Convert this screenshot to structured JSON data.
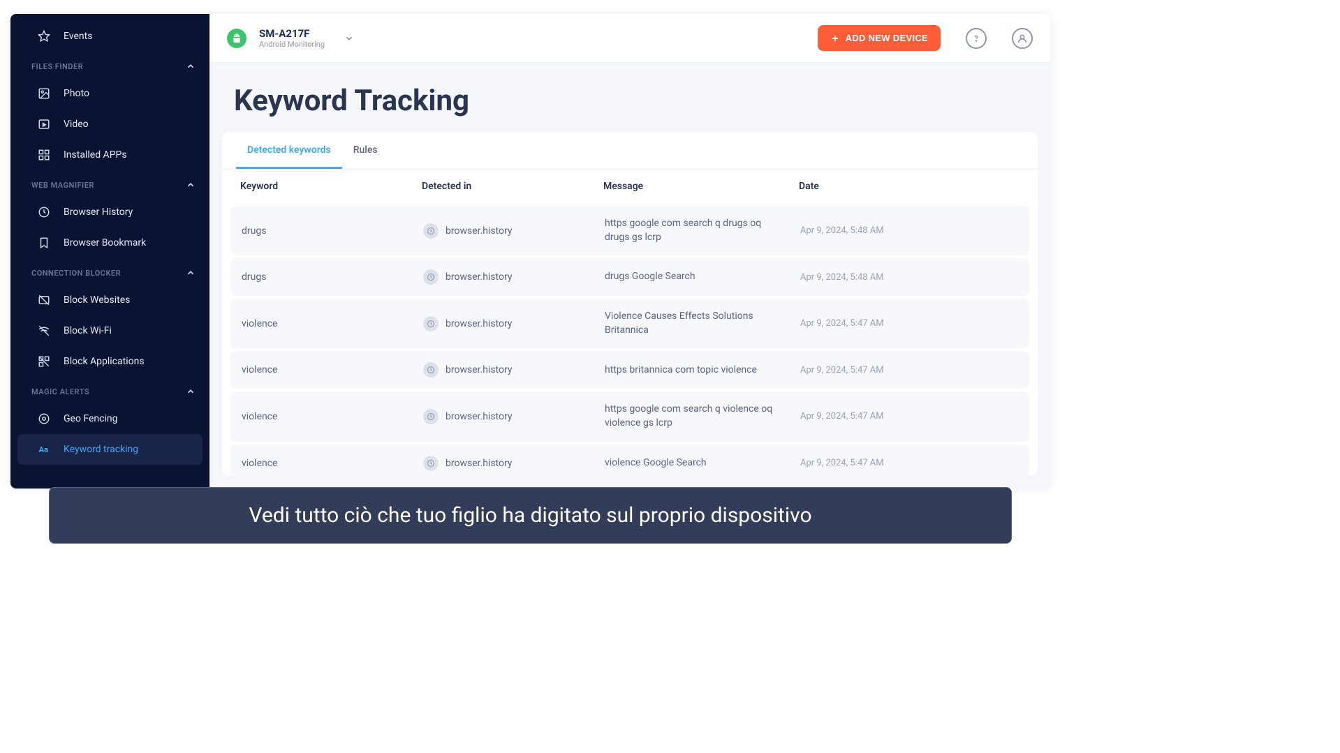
{
  "sidebar": {
    "items": [
      {
        "label": "Events",
        "icon": "star"
      }
    ],
    "sections": [
      {
        "title": "FILES FINDER",
        "items": [
          {
            "label": "Photo",
            "icon": "photo"
          },
          {
            "label": "Video",
            "icon": "video"
          },
          {
            "label": "Installed APPs",
            "icon": "apps"
          }
        ]
      },
      {
        "title": "WEB MAGNIFIER",
        "items": [
          {
            "label": "Browser History",
            "icon": "clock"
          },
          {
            "label": "Browser Bookmark",
            "icon": "bookmark"
          }
        ]
      },
      {
        "title": "CONNECTION BLOCKER",
        "items": [
          {
            "label": "Block Websites",
            "icon": "block-site"
          },
          {
            "label": "Block Wi-Fi",
            "icon": "block-wifi"
          },
          {
            "label": "Block Applications",
            "icon": "block-apps"
          }
        ]
      },
      {
        "title": "MAGIC ALERTS",
        "items": [
          {
            "label": "Geo Fencing",
            "icon": "geofence"
          },
          {
            "label": "Keyword tracking",
            "icon": "keyword",
            "active": true
          }
        ]
      }
    ]
  },
  "topbar": {
    "device_name": "SM-A217F",
    "device_sub": "Android Monitoring",
    "add_label": "ADD NEW DEVICE"
  },
  "page": {
    "title": "Keyword Tracking",
    "tabs": [
      "Detected keywords",
      "Rules"
    ],
    "columns": [
      "Keyword",
      "Detected in",
      "Message",
      "Date"
    ],
    "rows": [
      {
        "keyword": "drugs",
        "detected": "browser.history",
        "message": "https google com search q drugs oq drugs gs lcrp",
        "date": "Apr 9, 2024, 5:48 AM"
      },
      {
        "keyword": "drugs",
        "detected": "browser.history",
        "message": "drugs Google Search",
        "date": "Apr 9, 2024, 5:48 AM"
      },
      {
        "keyword": "violence",
        "detected": "browser.history",
        "message": "Violence Causes Effects Solutions Britannica",
        "date": "Apr 9, 2024, 5:47 AM"
      },
      {
        "keyword": "violence",
        "detected": "browser.history",
        "message": "https britannica com topic violence",
        "date": "Apr 9, 2024, 5:47 AM"
      },
      {
        "keyword": "violence",
        "detected": "browser.history",
        "message": "https google com search q violence oq violence gs lcrp",
        "date": "Apr 9, 2024, 5:47 AM"
      },
      {
        "keyword": "violence",
        "detected": "browser.history",
        "message": "violence Google Search",
        "date": "Apr 9, 2024, 5:47 AM"
      }
    ]
  },
  "caption": "Vedi tutto ciò che tuo figlio ha digitato sul proprio dispositivo"
}
